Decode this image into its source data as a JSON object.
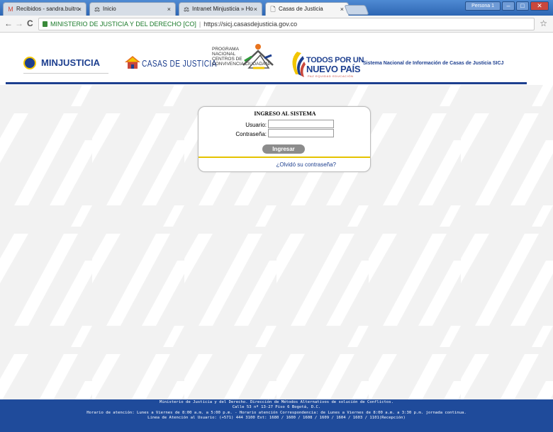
{
  "browser": {
    "tabs": [
      {
        "label": "Recibidos - sandra.buitro",
        "icon": "M"
      },
      {
        "label": "Inicio",
        "icon": "⚖"
      },
      {
        "label": "Intranet Minjusticia » Ho",
        "icon": "⚖"
      },
      {
        "label": "Casas de Justicia",
        "icon": "🗋"
      }
    ],
    "tab_close": "×",
    "profile_label": "Persona 1",
    "controls": {
      "minimize": "–",
      "maximize": "□",
      "close": "✕"
    },
    "back": "←",
    "forward": "→",
    "reload": "C",
    "address": {
      "site": "MINISTERIO DE JUSTICIA Y DEL DERECHO [CO]",
      "separator": "|",
      "url": "https://sicj.casasdejusticia.gov.co"
    },
    "bookmark": "☆"
  },
  "header": {
    "minjusticia": "MINJUSTICIA",
    "casas": "CASAS DE JUSTICIA",
    "programa_lines": "PROGRAMA\nNACIONAL\nCENTROS DE\nCONVIVENCIA CIUDADANA",
    "tpn_line1": "TODOS POR UN",
    "tpn_line2": "NUEVO PAÍS",
    "tpn_line3": "PAZ  EQUIDAD  EDUCACIÓN",
    "system_name": "Sistema Nacional de Información de Casas de Justicia SICJ"
  },
  "login": {
    "title": "INGRESO AL SISTEMA",
    "user_label": "Usuario:",
    "user_value": "",
    "password_label": "Contraseña:",
    "password_value": "",
    "submit": "Ingresar",
    "forgot": "¿Olvidó su contraseña?"
  },
  "footer": {
    "line1": "Ministerio de Justicia y del Derecho. Dirección de Métodos Alternativos de solución de Conflictos.",
    "line2": "Calle 53 nº 13-27 Piso 6 Bogotá, D.C.",
    "line3": "Horario de atención: Lunes a Viernes de 8:00 a.m. a 5:00 p.m. - Horario atención Correspondencia: de Lunes a Viernes de 8:00 a.m. a 3:30 p.m. jornada continua.",
    "line4": "Linea de Atención al Usuario: (+571) 444 3100 Ext: 1680 / 1600 / 1608 / 1609 / 1604 / 1603 / 1101(Recepción)"
  },
  "colors": {
    "brand_blue": "#1d3f8f",
    "footer_blue": "#1f4b9b",
    "accent_yellow": "#e5c300",
    "button_gray": "#8c8c8c"
  }
}
